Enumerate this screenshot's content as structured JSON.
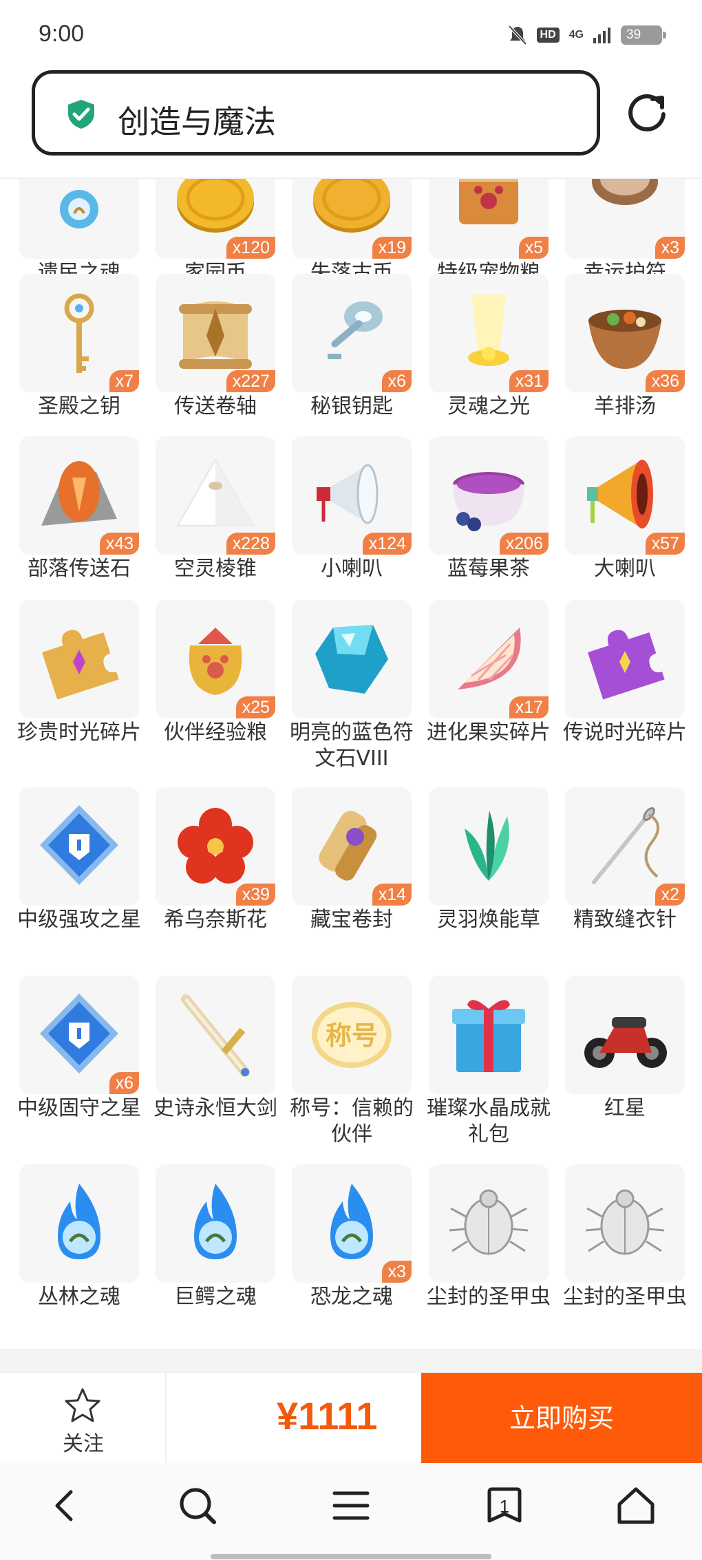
{
  "status_bar": {
    "time": "9:00",
    "hd_label": "HD",
    "network_label": "4G",
    "battery_level": "39"
  },
  "address_bar": {
    "title": "创造与魔法",
    "secure_icon": "shield-check-icon",
    "refresh_icon": "refresh-icon"
  },
  "items": [
    {
      "name": "遗民之魂",
      "qty": "",
      "icon": "soul-orb-icon",
      "color": "#5ab8e8"
    },
    {
      "name": "家园币",
      "qty": "x120",
      "icon": "gold-coin-icon",
      "color": "#f2b92a"
    },
    {
      "name": "失落古币",
      "qty": "x19",
      "icon": "gold-coin-icon",
      "color": "#f0b030"
    },
    {
      "name": "特级宠物粮",
      "qty": "x5",
      "icon": "pet-food-box-icon",
      "color": "#d98a3a"
    },
    {
      "name": "幸运护符",
      "qty": "x3",
      "icon": "wood-amulet-icon",
      "color": "#9b6b45"
    },
    {
      "name": "圣殿之钥",
      "qty": "x7",
      "icon": "golden-key-icon",
      "color": "#d9a84a"
    },
    {
      "name": "传送卷轴",
      "qty": "x227",
      "icon": "scroll-icon",
      "color": "#c89650"
    },
    {
      "name": "秘银钥匙",
      "qty": "x6",
      "icon": "silver-key-icon",
      "color": "#a9c8d8"
    },
    {
      "name": "灵魂之光",
      "qty": "x31",
      "icon": "light-beam-icon",
      "color": "#f7d23a"
    },
    {
      "name": "羊排汤",
      "qty": "x36",
      "icon": "soup-bowl-icon",
      "color": "#b5723d"
    },
    {
      "name": "部落传送石",
      "qty": "x43",
      "icon": "teleport-stone-icon",
      "color": "#e7712a"
    },
    {
      "name": "空灵棱锥",
      "qty": "x228",
      "icon": "pyramid-icon",
      "color": "#eeeeee"
    },
    {
      "name": "小喇叭",
      "qty": "x124",
      "icon": "small-megaphone-icon",
      "color": "#cc2b3a"
    },
    {
      "name": "蓝莓果茶",
      "qty": "x206",
      "icon": "tea-cup-icon",
      "color": "#9a3ea6"
    },
    {
      "name": "大喇叭",
      "qty": "x57",
      "icon": "big-megaphone-icon",
      "color": "#f2a82b"
    },
    {
      "name": "珍贵时光碎片",
      "qty": "",
      "icon": "gold-puzzle-piece-icon",
      "color": "#e6b04a"
    },
    {
      "name": "伙伴经验粮",
      "qty": "x25",
      "icon": "treat-bag-icon",
      "color": "#e8b43a"
    },
    {
      "name": "明亮的蓝色符文石VIII",
      "qty": "",
      "icon": "blue-crystal-icon",
      "color": "#1fa0c8"
    },
    {
      "name": "进化果实碎片",
      "qty": "x17",
      "icon": "fruit-slice-icon",
      "color": "#e87a8a"
    },
    {
      "name": "传说时光碎片",
      "qty": "",
      "icon": "purple-puzzle-piece-icon",
      "color": "#a54fd6"
    },
    {
      "name": "中级强攻之星",
      "qty": "",
      "icon": "blue-star-gem-icon",
      "color": "#2f7be0"
    },
    {
      "name": "希乌奈斯花",
      "qty": "x39",
      "icon": "red-flower-icon",
      "color": "#e0341f"
    },
    {
      "name": "藏宝卷封",
      "qty": "x14",
      "icon": "sealed-scroll-icon",
      "color": "#c8903c"
    },
    {
      "name": "灵羽焕能草",
      "qty": "",
      "icon": "green-herb-icon",
      "color": "#2bb58a"
    },
    {
      "name": "精致缝衣针",
      "qty": "x2",
      "icon": "needle-icon",
      "color": "#b79a6a"
    },
    {
      "name": "中级固守之星",
      "qty": "x6",
      "icon": "blue-star-gem-icon",
      "color": "#2f7be0"
    },
    {
      "name": "史诗永恒大剑",
      "qty": "",
      "icon": "sword-icon",
      "color": "#d8b048"
    },
    {
      "name": "称号：信赖的伙伴",
      "qty": "",
      "icon": "title-badge-icon",
      "color": "#e6b64c",
      "badge_text": "称号"
    },
    {
      "name": "璀璨水晶成就礼包",
      "qty": "",
      "icon": "gift-box-icon",
      "color": "#3aa6e0"
    },
    {
      "name": "红星",
      "qty": "",
      "icon": "motorcycle-icon",
      "color": "#3a3a3a"
    },
    {
      "name": "丛林之魂",
      "qty": "",
      "icon": "blue-flame-soul-icon",
      "color": "#2a8ef0"
    },
    {
      "name": "巨鳄之魂",
      "qty": "",
      "icon": "blue-flame-soul-icon",
      "color": "#2a8ef0"
    },
    {
      "name": "恐龙之魂",
      "qty": "x3",
      "icon": "blue-flame-soul-icon",
      "color": "#2a8ef0"
    },
    {
      "name": "尘封的圣甲虫",
      "qty": "",
      "icon": "beetle-icon",
      "color": "#9a9a9a"
    },
    {
      "name": "尘封的圣甲虫",
      "qty": "",
      "icon": "beetle-icon",
      "color": "#9a9a9a"
    }
  ],
  "buy_bar": {
    "follow_label": "关注",
    "price": "¥1111",
    "buy_label": "立即购买"
  },
  "bottom_nav": {
    "tab_count": "1",
    "items": [
      "back-icon",
      "search-icon",
      "menu-icon",
      "tabs-icon",
      "home-icon"
    ]
  },
  "colors": {
    "accent": "#ff5a0a",
    "price": "#f25a0c",
    "quantity_badge": "#f08046",
    "secure": "#21a67a"
  }
}
